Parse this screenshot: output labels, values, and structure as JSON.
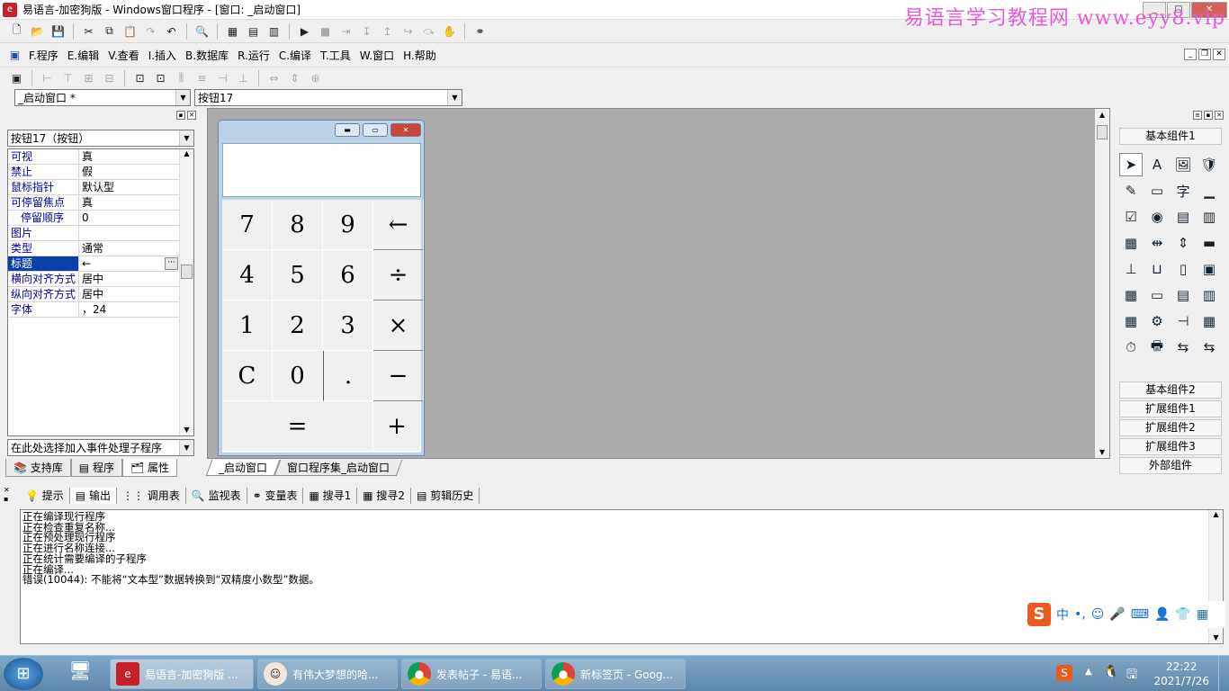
{
  "window": {
    "title": "易语言-加密狗版 - Windows窗口程序 - [窗口: _启动窗口]",
    "watermark": "易语言学习教程网 www.eyy8.vip"
  },
  "menu": [
    "F.程序",
    "E.编辑",
    "V.查看",
    "I.插入",
    "B.数据库",
    "R.运行",
    "C.编译",
    "T.工具",
    "W.窗口",
    "H.帮助"
  ],
  "combos": {
    "window_select": "_启动窗口 *",
    "control_select": "按钮17"
  },
  "left_panel": {
    "object_select": "按钮17（按钮）",
    "properties": [
      {
        "name": "可视",
        "value": "真"
      },
      {
        "name": "禁止",
        "value": "假"
      },
      {
        "name": "鼠标指针",
        "value": "默认型"
      },
      {
        "name": "可停留焦点",
        "value": "真"
      },
      {
        "name": "  停留顺序",
        "value": "0"
      },
      {
        "name": "图片",
        "value": ""
      },
      {
        "name": "类型",
        "value": "通常"
      },
      {
        "name": "标题",
        "value": "←"
      },
      {
        "name": "横向对齐方式",
        "value": "居中"
      },
      {
        "name": "纵向对齐方式",
        "value": "居中"
      },
      {
        "name": "字体",
        "value": "，24"
      }
    ],
    "event_select": "在此处选择加入事件处理子程序",
    "tabs": [
      "支持库",
      "程序",
      "属性"
    ]
  },
  "calculator": {
    "keys": [
      "7",
      "8",
      "9",
      "←",
      "4",
      "5",
      "6",
      "÷",
      "1",
      "2",
      "3",
      "×",
      "C",
      "0",
      ".",
      "−",
      "=",
      "+"
    ]
  },
  "doc_tabs": [
    "_启动窗口",
    "窗口程序集_启动窗口"
  ],
  "right_panel": {
    "groups": [
      "基本组件1",
      "基本组件2",
      "扩展组件1",
      "扩展组件2",
      "扩展组件3",
      "外部组件"
    ]
  },
  "output": {
    "tabs": [
      "提示",
      "输出",
      "调用表",
      "监视表",
      "变量表",
      "搜寻1",
      "搜寻2",
      "剪辑历史"
    ],
    "lines": [
      "正在编译现行程序",
      "正在检查重复名称...",
      "正在预处理现行程序",
      "正在进行名称连接...",
      "正在统计需要编译的子程序",
      "正在编译...",
      "错误(10044): 不能将“文本型”数据转换到“双精度小数型”数据。"
    ]
  },
  "ime": {
    "mode": "中"
  },
  "taskbar": {
    "items": [
      "易语言-加密狗版 ...",
      "有伟大梦想的哈...",
      "发表帖子 - 易语...",
      "新标签页 - Goog..."
    ],
    "time": "22:22",
    "date": "2021/7/26"
  }
}
